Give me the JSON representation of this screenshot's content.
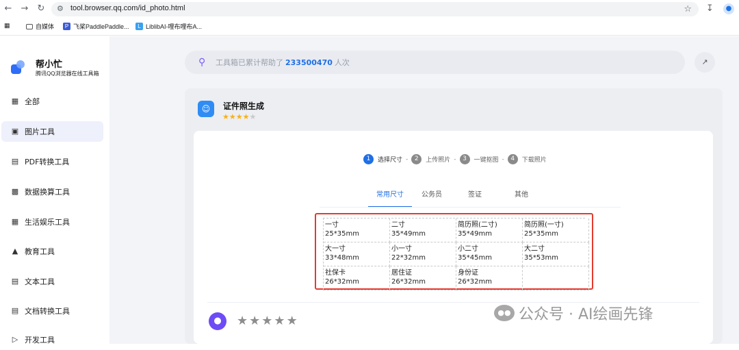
{
  "browser": {
    "url": "tool.browser.qq.com/id_photo.html",
    "bookmarks": [
      {
        "label": "自媒体",
        "icon": "folder-icon"
      },
      {
        "label": "飞桨PaddlePaddle...",
        "icon": "paddle-icon"
      },
      {
        "label": "LiblibAI-哩布哩布A...",
        "icon": "liblib-icon"
      }
    ]
  },
  "sidebar": {
    "brand_title": "帮小忙",
    "brand_subtitle": "腾讯QQ浏览器在线工具箱",
    "items": [
      {
        "label": "全部",
        "icon": "grid-icon",
        "active": false
      },
      {
        "label": "图片工具",
        "icon": "image-icon",
        "active": true
      },
      {
        "label": "PDF转换工具",
        "icon": "pdf-icon",
        "active": false
      },
      {
        "label": "数据换算工具",
        "icon": "chart-icon",
        "active": false
      },
      {
        "label": "生活娱乐工具",
        "icon": "calendar-icon",
        "active": false
      },
      {
        "label": "教育工具",
        "icon": "school-icon",
        "active": false
      },
      {
        "label": "文本工具",
        "icon": "text-icon",
        "active": false
      },
      {
        "label": "文档转换工具",
        "icon": "document-icon",
        "active": false
      },
      {
        "label": "开发工具",
        "icon": "code-icon",
        "active": false
      }
    ]
  },
  "search": {
    "prefix": "工具箱已累计帮助了",
    "count": "233500470",
    "suffix": "人次"
  },
  "tool": {
    "title": "证件照生成",
    "rating": 4,
    "steps": [
      {
        "num": "1",
        "label": "选择尺寸",
        "active": true
      },
      {
        "num": "2",
        "label": "上传照片",
        "active": false
      },
      {
        "num": "3",
        "label": "一键抠图",
        "active": false
      },
      {
        "num": "4",
        "label": "下载照片",
        "active": false
      }
    ],
    "tabs": [
      {
        "label": "常用尺寸",
        "active": true
      },
      {
        "label": "公务员",
        "active": false
      },
      {
        "label": "签证",
        "active": false
      },
      {
        "label": "其他",
        "active": false
      }
    ],
    "sizes": [
      {
        "name": "一寸",
        "dim": "25*35mm"
      },
      {
        "name": "二寸",
        "dim": "35*49mm"
      },
      {
        "name": "简历照(二寸)",
        "dim": "35*49mm"
      },
      {
        "name": "简历照(一寸)",
        "dim": "25*35mm"
      },
      {
        "name": "大一寸",
        "dim": "33*48mm"
      },
      {
        "name": "小一寸",
        "dim": "22*32mm"
      },
      {
        "name": "小二寸",
        "dim": "35*45mm"
      },
      {
        "name": "大二寸",
        "dim": "35*53mm"
      },
      {
        "name": "社保卡",
        "dim": "26*32mm"
      },
      {
        "name": "居住证",
        "dim": "26*32mm"
      },
      {
        "name": "身份证",
        "dim": "26*32mm"
      },
      {
        "name": "",
        "dim": ""
      }
    ]
  },
  "watermark": "公众号 · AI绘画先锋",
  "colors": {
    "accent": "#1f6fe5",
    "highlight": "#e33a2f",
    "star": "#f6b21b"
  }
}
